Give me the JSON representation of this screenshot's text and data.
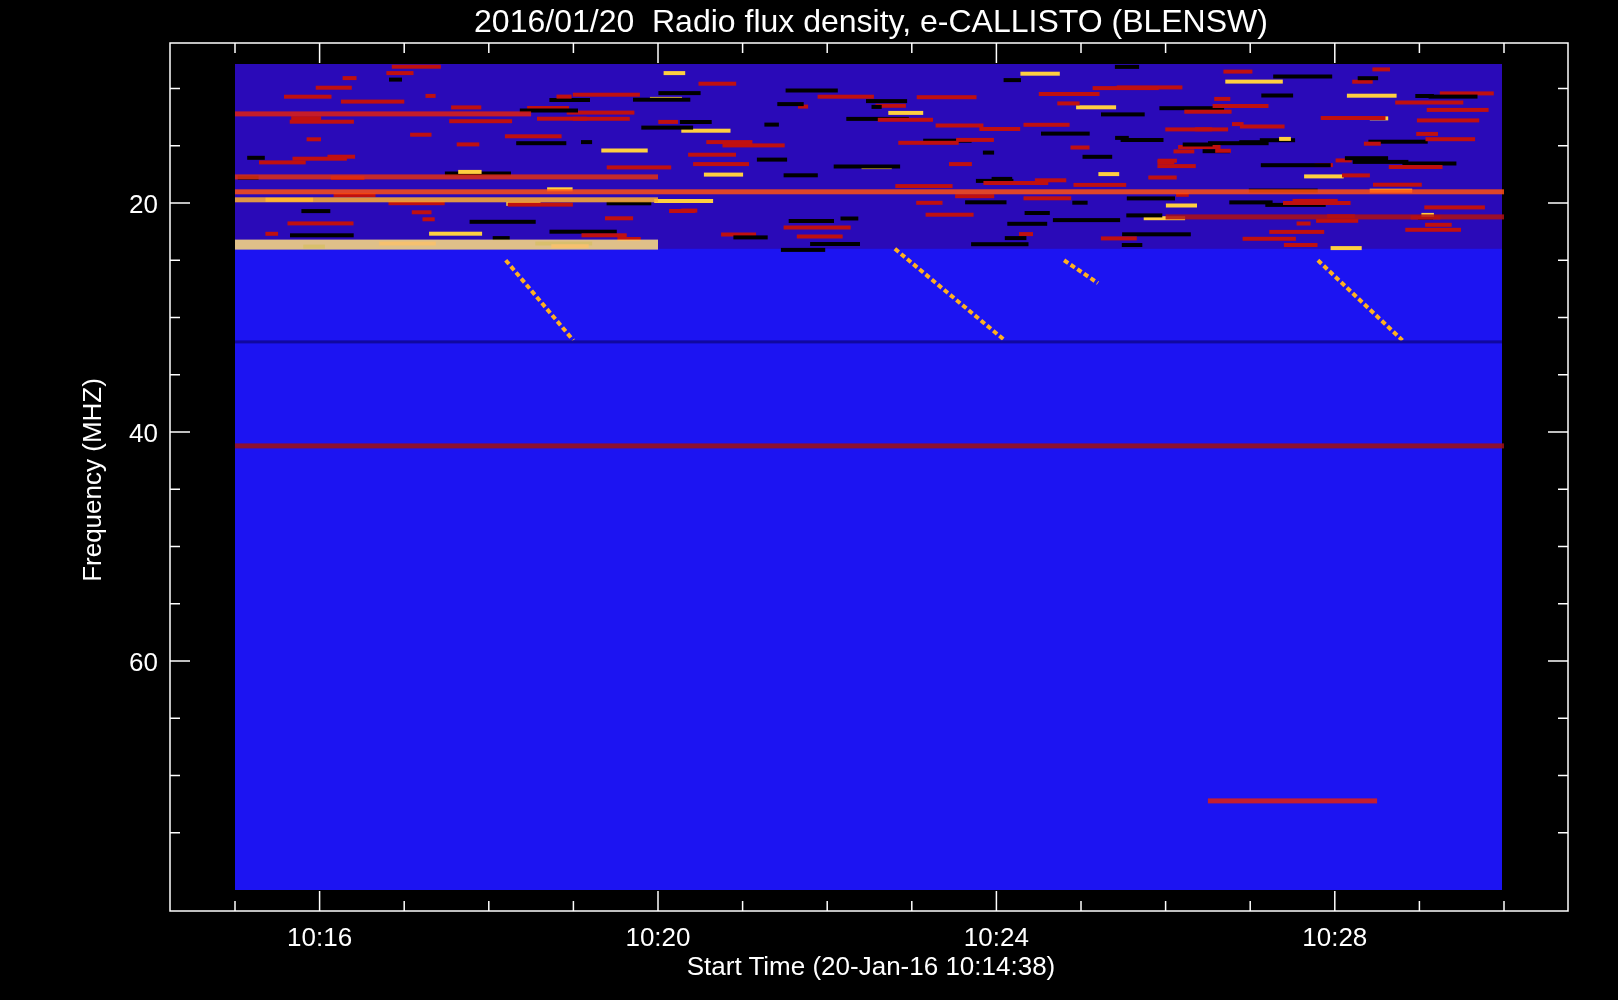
{
  "title": "2016/01/20  Radio flux density, e-CALLISTO (BLENSW)",
  "y_axis": {
    "label": "Frequency (MHZ)",
    "ticks": [
      "20",
      "40",
      "60"
    ]
  },
  "x_axis": {
    "label": "Start Time (20-Jan-16 10:14:38)",
    "ticks": [
      "10:16",
      "10:20",
      "10:24",
      "10:28"
    ]
  }
}
